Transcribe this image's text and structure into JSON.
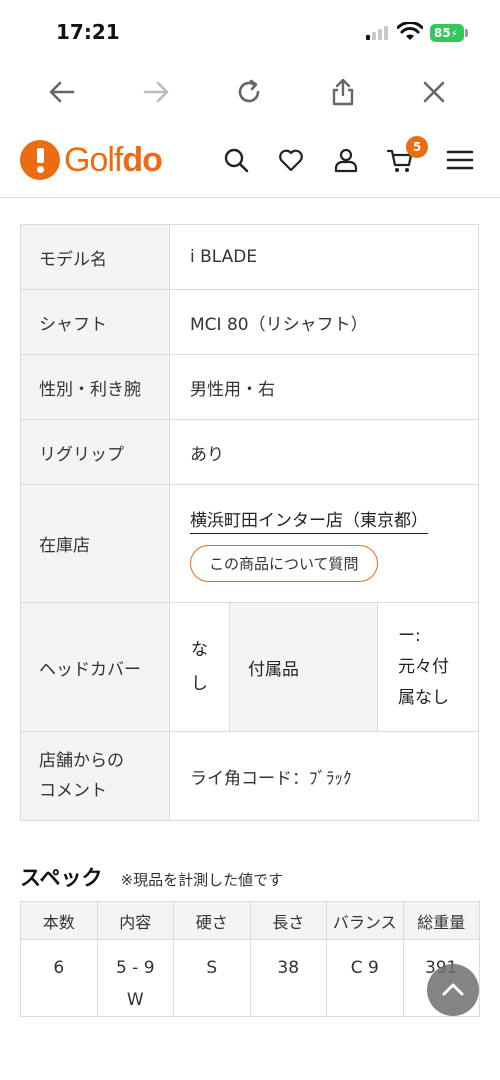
{
  "status_bar": {
    "time": "17:21",
    "battery": "85"
  },
  "site": {
    "logo_prefix": "Golf",
    "logo_suffix": "do",
    "cart_count": "5"
  },
  "details": {
    "model_label": "モデル名",
    "model_value": "i BLADE",
    "shaft_label": "シャフト",
    "shaft_value": "MCI 80（リシャフト）",
    "gender_label": "性別・利き腕",
    "gender_value": "男性用・右",
    "regrip_label": "リグリップ",
    "regrip_value": "あり",
    "store_label": "在庫店",
    "store_value": "横浜町田インター店（東京都）",
    "ask_button": "この商品について質問",
    "headcover_label": "ヘッドカバー",
    "headcover_value_line1": "な",
    "headcover_value_line2": "し",
    "accessories_label": "付属品",
    "accessories_value_line1": "ー:",
    "accessories_value_line2": "元々付",
    "accessories_value_line3": "属なし",
    "comment_label_line1": "店舗からの",
    "comment_label_line2": "コメント",
    "comment_value": "ライ角コード：ﾌﾞﾗｯｸ"
  },
  "spec": {
    "title": "スペック",
    "note": "※現品を計測した値です",
    "headers": [
      "本数",
      "内容",
      "硬さ",
      "長さ",
      "バランス",
      "総重量"
    ],
    "row": [
      "6",
      "5 - 9",
      "S",
      "38",
      "C 9",
      "391"
    ],
    "row_contents_line2": "W"
  },
  "icons": {
    "back": "arrow-left-icon",
    "forward": "arrow-right-icon",
    "reload": "reload-icon",
    "share": "share-icon",
    "close": "close-icon",
    "search": "search-icon",
    "favorite": "heart-icon",
    "account": "user-icon",
    "cart": "cart-icon",
    "menu": "hamburger-menu-icon",
    "scroll_top": "chevron-up-icon"
  },
  "colors": {
    "brand": "#ec6c14",
    "battery": "#34c759"
  }
}
